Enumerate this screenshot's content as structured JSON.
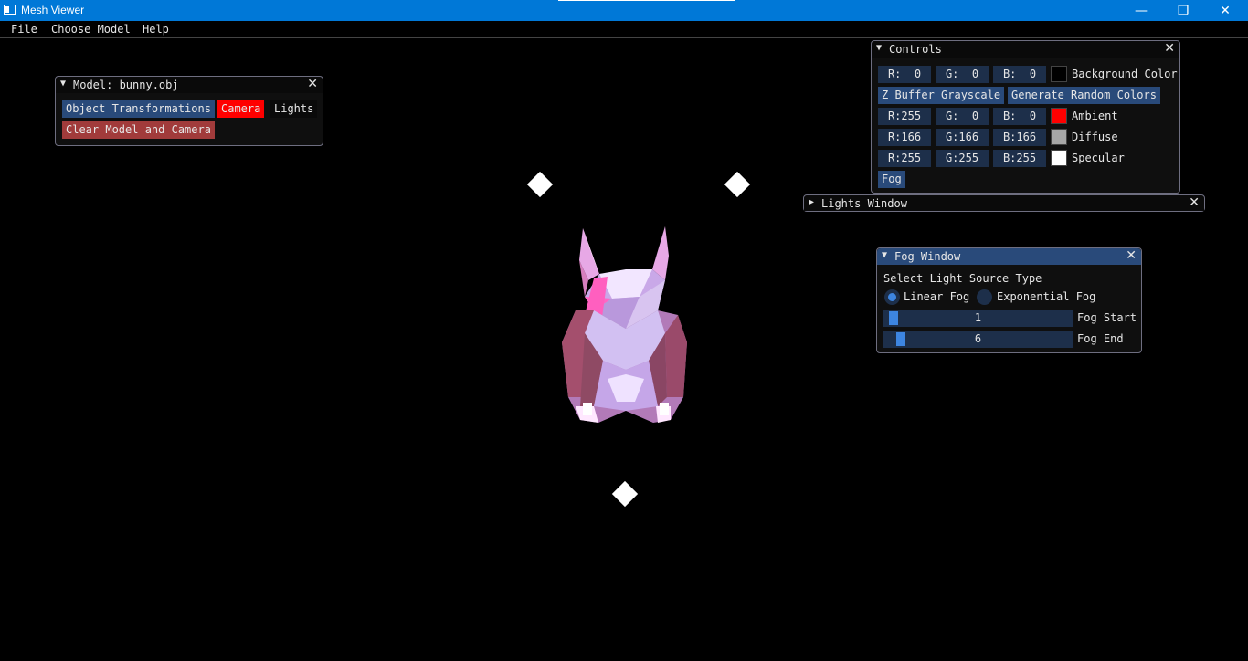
{
  "window": {
    "title": "Mesh Viewer",
    "minimize": "—",
    "restore": "❐",
    "close": "✕"
  },
  "menu": {
    "items": [
      "File",
      "Choose Model",
      "Help"
    ]
  },
  "model_window": {
    "arrow": "▼",
    "title": "Model: bunny.obj",
    "close": "✕",
    "buttons": {
      "object_transformations": "Object Transformations",
      "camera": "Camera",
      "lights": "Lights",
      "clear": "Clear Model and Camera"
    }
  },
  "controls": {
    "arrow": "▼",
    "title": "Controls",
    "close": "✕",
    "background": {
      "r": "R:  0",
      "g": "G:  0",
      "b": "B:  0",
      "label": "Background Color",
      "color": "#000000"
    },
    "zbuffer_label": "Z Buffer Grayscale",
    "random_colors_label": "Generate Random Colors",
    "ambient": {
      "r": "R:255",
      "g": "G:  0",
      "b": "B:  0",
      "label": "Ambient",
      "color": "#ff0000"
    },
    "diffuse": {
      "r": "R:166",
      "g": "G:166",
      "b": "B:166",
      "label": "Diffuse",
      "color": "#a6a6a6"
    },
    "specular": {
      "r": "R:255",
      "g": "G:255",
      "b": "B:255",
      "label": "Specular",
      "color": "#ffffff"
    },
    "fog_label": "Fog"
  },
  "lights_window": {
    "arrow": "▶",
    "title": "Lights Window",
    "close": "✕"
  },
  "fog_window": {
    "arrow": "▼",
    "title": "Fog Window",
    "close": "✕",
    "heading": "Select Light Source Type",
    "linear_label": "Linear Fog",
    "exponential_label": "Exponential Fog",
    "selected": "linear",
    "fog_start": {
      "value": "1",
      "label": "Fog Start",
      "fraction": 0.02
    },
    "fog_end": {
      "value": "6",
      "label": "Fog End",
      "fraction": 0.06
    }
  },
  "colors": {
    "accent": "#294a7a",
    "camera_active": "#ff0000",
    "clear_button": "#a13b3b",
    "slider_grab": "#3d85e0"
  }
}
